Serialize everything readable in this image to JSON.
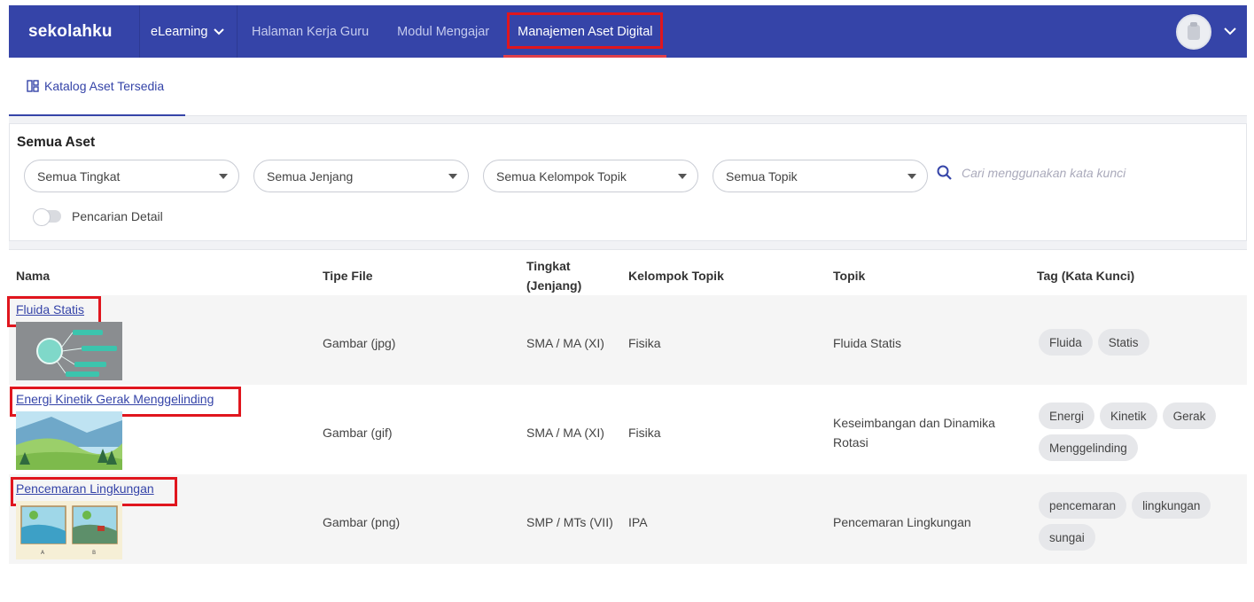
{
  "nav": {
    "logo": "sekolahku",
    "elearning": "eLearning",
    "items": [
      "Halaman Kerja Guru",
      "Modul Mengajar",
      "Manajemen Aset Digital"
    ]
  },
  "tabs": {
    "catalog": "Katalog Aset Tersedia"
  },
  "filters": {
    "title": "Semua Aset",
    "tingkat": "Semua Tingkat",
    "jenjang": "Semua Jenjang",
    "kelompok": "Semua Kelompok Topik",
    "topik": "Semua Topik",
    "search_placeholder": "Cari menggunakan kata kunci",
    "detail_toggle": "Pencarian Detail"
  },
  "table": {
    "headers": {
      "nama": "Nama",
      "tipe": "Tipe File",
      "tingkat_line1": "Tingkat",
      "tingkat_line2": "(Jenjang)",
      "kelompok": "Kelompok Topik",
      "topik": "Topik",
      "tag": "Tag (Kata Kunci)"
    },
    "rows": [
      {
        "nama": "Fluida Statis",
        "tipe": "Gambar (jpg)",
        "tingkat": "SMA / MA (XI)",
        "kelompok": "Fisika",
        "topik_line1": "Fluida Statis",
        "topik_line2": "",
        "tags": [
          "Fluida",
          "Statis"
        ]
      },
      {
        "nama": "Energi Kinetik Gerak Menggelinding",
        "tipe": "Gambar (gif)",
        "tingkat": "SMA / MA (XI)",
        "kelompok": "Fisika",
        "topik_line1": "Keseimbangan dan Dinamika",
        "topik_line2": "Rotasi",
        "tags": [
          "Energi",
          "Kinetik",
          "Gerak",
          "Menggelinding"
        ]
      },
      {
        "nama": "Pencemaran Lingkungan",
        "tipe": "Gambar (png)",
        "tingkat": "SMP / MTs (VII)",
        "kelompok": "IPA",
        "topik_line1": "Pencemaran Lingkungan",
        "topik_line2": "",
        "tags": [
          "pencemaran",
          "lingkungan",
          "sungai"
        ]
      }
    ]
  },
  "colors": {
    "brand": "#3544a8",
    "highlight": "#e0161e",
    "active_underline": "#e0404a"
  }
}
